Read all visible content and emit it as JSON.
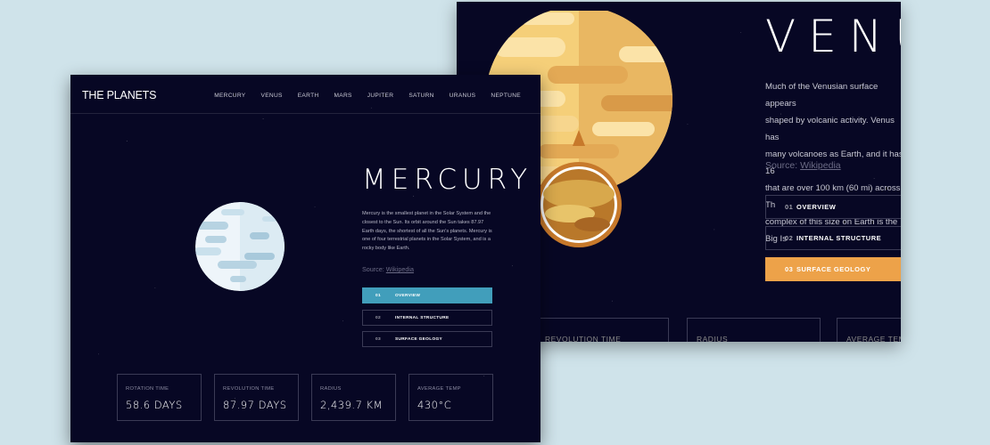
{
  "venus": {
    "title": "VENUS",
    "description": "Much of the Venusian surface appears\nshaped by volcanic activity. Venus has\nmany volcanoes as Earth, and it has 16\nthat are over 100 km (60 mi) across. Th\ncomplex of this size on Earth is the Big Is",
    "source_label": "Source:",
    "source_link": "Wikipedia",
    "tabs": [
      {
        "num": "01",
        "label": "OVERVIEW"
      },
      {
        "num": "02",
        "label": "INTERNAL STRUCTURE"
      },
      {
        "num": "03",
        "label": "SURFACE GEOLOGY"
      }
    ],
    "stats": [
      "REVOLUTION TIME",
      "RADIUS",
      "AVERAGE TEM"
    ],
    "colors": {
      "accent": "#eda249",
      "planet": "#f2c66f"
    }
  },
  "mercury": {
    "logo": "THE PLANETS",
    "nav": [
      "MERCURY",
      "VENUS",
      "EARTH",
      "MARS",
      "JUPITER",
      "SATURN",
      "URANUS",
      "NEPTUNE"
    ],
    "title": "MERCURY",
    "description": "Mercury is the smallest planet in the Solar System and the closest to the Sun. Its orbit around the Sun takes 87.97 Earth days, the shortest of all the Sun's planets. Mercury is one of four terrestrial planets in the Solar System, and is a rocky body like Earth.",
    "source_label": "Source:",
    "source_link": "Wikipedia",
    "tabs": [
      {
        "num": "01",
        "label": "OVERVIEW"
      },
      {
        "num": "02",
        "label": "INTERNAL STRUCTURE"
      },
      {
        "num": "03",
        "label": "SURFACE GEOLOGY"
      }
    ],
    "stats": [
      {
        "label": "ROTATION TIME",
        "value": "58.6 DAYS"
      },
      {
        "label": "REVOLUTION TIME",
        "value": "87.97 DAYS"
      },
      {
        "label": "RADIUS",
        "value": "2,439.7 KM"
      },
      {
        "label": "AVERAGE TEMP",
        "value": "430°C"
      }
    ],
    "colors": {
      "accent": "#419ebb",
      "planet": "#dcecf4"
    }
  },
  "colors": {
    "background": "#cfe3ea",
    "space": "#070724",
    "border": "#3a3a55"
  }
}
